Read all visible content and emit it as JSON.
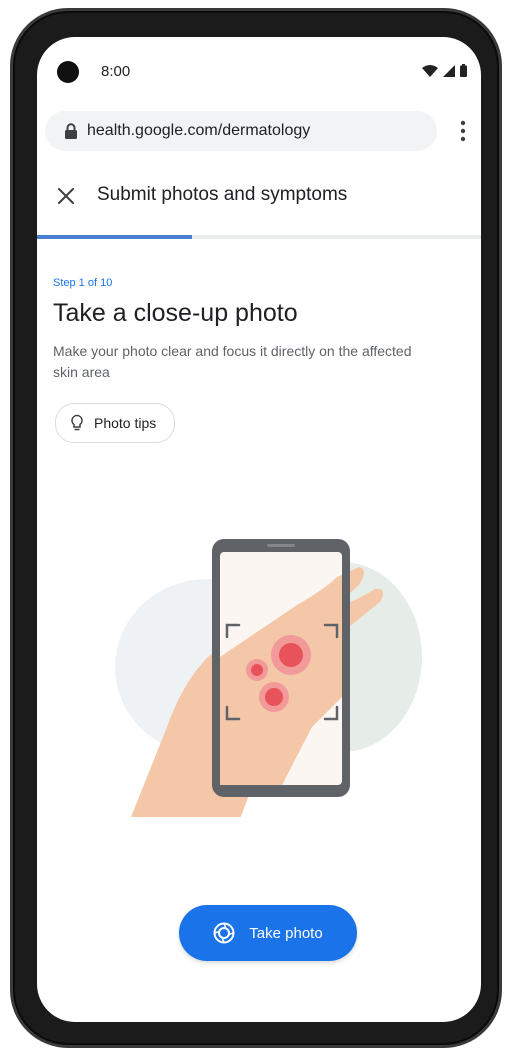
{
  "status_bar": {
    "time": "8:00",
    "icons": [
      "wifi-icon",
      "signal-icon",
      "battery-icon"
    ]
  },
  "browser": {
    "url": "health.google.com/dermatology"
  },
  "header": {
    "title": "Submit photos and symptoms"
  },
  "progress": {
    "current_step": 1,
    "total_steps": 10,
    "fraction": 0.35
  },
  "content": {
    "step_label": "Step 1 of 10",
    "title": "Take a close-up photo",
    "description": "Make your photo clear and focus it directly on the affected skin area",
    "tips_button": "Photo tips"
  },
  "action": {
    "take_photo_label": "Take photo"
  },
  "colors": {
    "accent": "#1a73e8",
    "progress": "#4a7fd0",
    "spot": "#e8525a",
    "skin": "#f4c7a8"
  }
}
